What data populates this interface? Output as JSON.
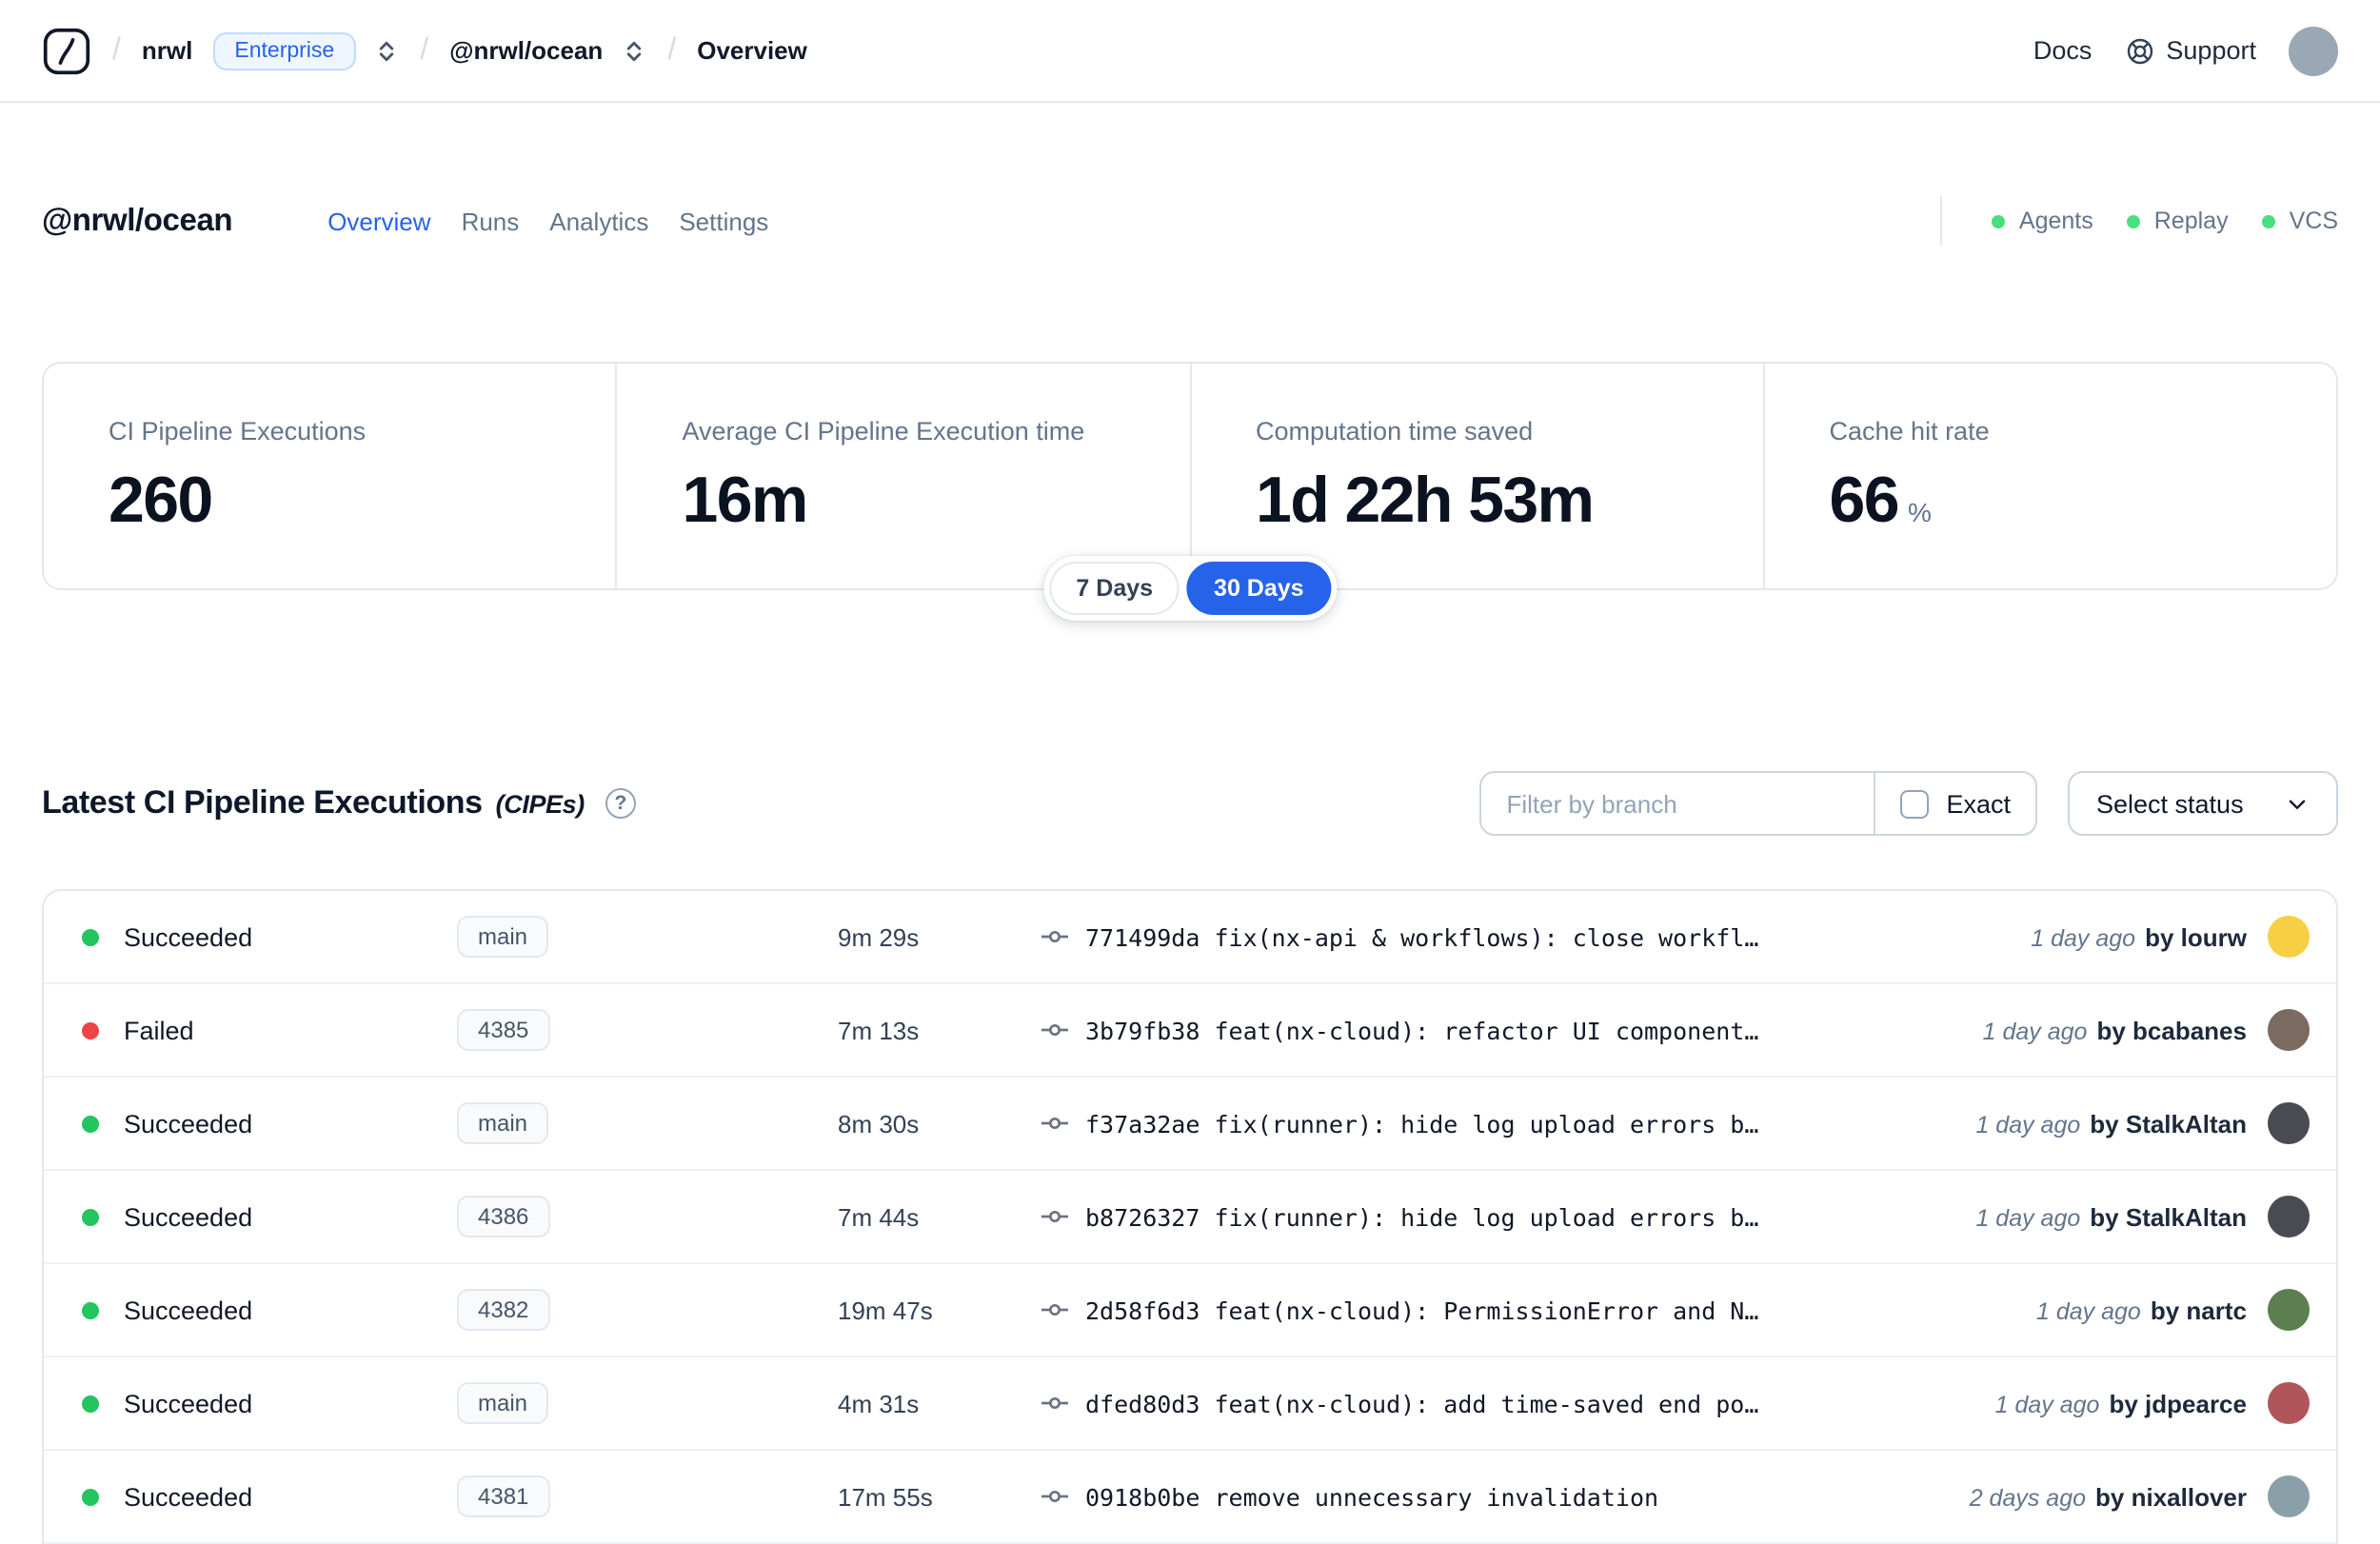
{
  "colors": {
    "accent": "#2563eb",
    "success": "#22c55e",
    "danger": "#ef4444"
  },
  "navbar": {
    "separator": "/",
    "org": "nrwl",
    "org_badge": "Enterprise",
    "workspace": "@nrwl/ocean",
    "page": "Overview",
    "docs_label": "Docs",
    "support_label": "Support"
  },
  "header": {
    "title": "@nrwl/ocean",
    "tabs": [
      {
        "label": "Overview"
      },
      {
        "label": "Runs"
      },
      {
        "label": "Analytics"
      },
      {
        "label": "Settings"
      }
    ],
    "indicators": [
      {
        "label": "Agents"
      },
      {
        "label": "Replay"
      },
      {
        "label": "VCS"
      }
    ]
  },
  "stats": {
    "cards": [
      {
        "label": "CI Pipeline Executions",
        "value": "260",
        "suffix": ""
      },
      {
        "label": "Average CI Pipeline Execution time",
        "value": "16m",
        "suffix": ""
      },
      {
        "label": "Computation time saved",
        "value": "1d 22h 53m",
        "suffix": ""
      },
      {
        "label": "Cache hit rate",
        "value": "66",
        "suffix": "%"
      }
    ],
    "range": {
      "d7": "7 Days",
      "d30": "30 Days",
      "selected": "30 Days"
    }
  },
  "icons": {
    "help": "?"
  },
  "executions": {
    "title": "Latest CI Pipeline Executions",
    "title_suffix": "(CIPEs)",
    "filter": {
      "placeholder": "Filter by branch",
      "exact_label": "Exact"
    },
    "status_select_label": "Select status",
    "rows": [
      {
        "status": "Succeeded",
        "branch": "main",
        "duration": "9m 29s",
        "commit": "771499da fix(nx-api & workflows): close workfl…",
        "time": "1 day ago",
        "author": "by lourw",
        "avatar_color": "#f6cf45"
      },
      {
        "status": "Failed",
        "branch": "4385",
        "duration": "7m 13s",
        "commit": "3b79fb38 feat(nx-cloud): refactor UI component…",
        "time": "1 day ago",
        "author": "by bcabanes",
        "avatar_color": "#7a6a5f"
      },
      {
        "status": "Succeeded",
        "branch": "main",
        "duration": "8m 30s",
        "commit": "f37a32ae fix(runner): hide log upload errors b…",
        "time": "1 day ago",
        "author": "by StalkAltan",
        "avatar_color": "#4a4a52"
      },
      {
        "status": "Succeeded",
        "branch": "4386",
        "duration": "7m 44s",
        "commit": "b8726327 fix(runner): hide log upload errors b…",
        "time": "1 day ago",
        "author": "by StalkAltan",
        "avatar_color": "#4a4a52"
      },
      {
        "status": "Succeeded",
        "branch": "4382",
        "duration": "19m 47s",
        "commit": "2d58f6d3 feat(nx-cloud): PermissionError and N…",
        "time": "1 day ago",
        "author": "by nartc",
        "avatar_color": "#5c7f52"
      },
      {
        "status": "Succeeded",
        "branch": "main",
        "duration": "4m 31s",
        "commit": "dfed80d3 feat(nx-cloud): add time-saved end po…",
        "time": "1 day ago",
        "author": "by jdpearce",
        "avatar_color": "#b0565a"
      },
      {
        "status": "Succeeded",
        "branch": "4381",
        "duration": "17m 55s",
        "commit": "0918b0be remove unnecessary invalidation",
        "time": "2 days ago",
        "author": "by nixallover",
        "avatar_color": "#8aa0a8"
      }
    ]
  }
}
